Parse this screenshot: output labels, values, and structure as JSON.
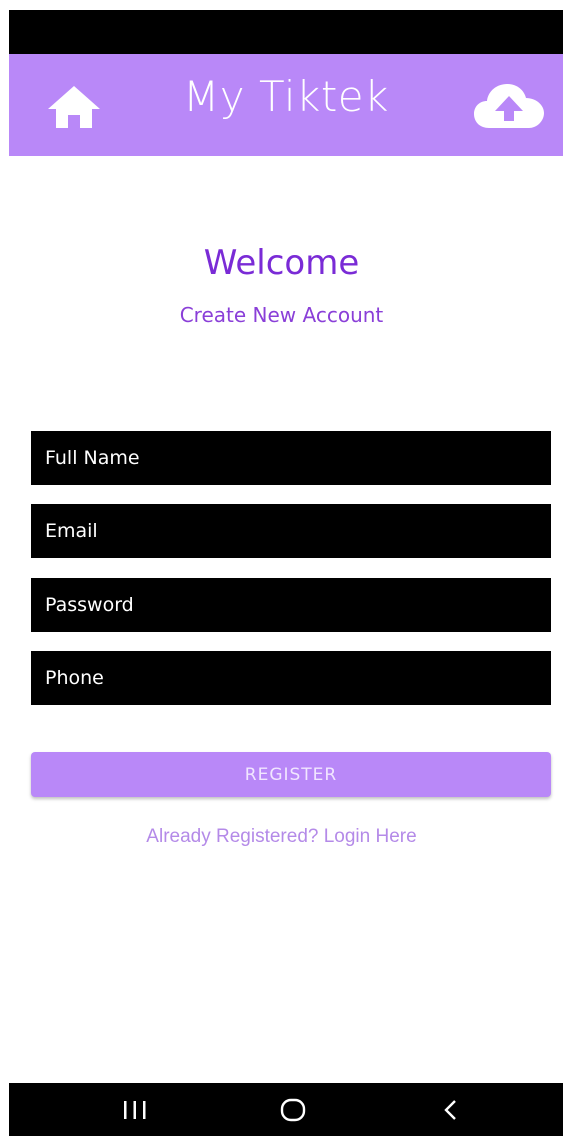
{
  "app_bar": {
    "title": "My Tiktek",
    "background": "#b988f8",
    "left_icon": "home-icon",
    "right_icon": "cloud-upload-icon"
  },
  "header": {
    "welcome": "Welcome",
    "subtitle": "Create New Account"
  },
  "form": {
    "full_name_placeholder": "Full Name",
    "email_placeholder": "Email",
    "password_placeholder": "Password",
    "phone_placeholder": "Phone",
    "full_name_value": "",
    "email_value": "",
    "password_value": "",
    "phone_value": ""
  },
  "register_label": "REGISTER",
  "login_link": "Already Registered? Login Here",
  "nav_bar": {
    "recents_icon": "recents-icon",
    "home_icon": "home-circle-icon",
    "back_icon": "back-chevron-icon"
  },
  "colors": {
    "accent": "#b988f8",
    "title_purple": "#7a2bd6",
    "field_bg": "#000000"
  }
}
